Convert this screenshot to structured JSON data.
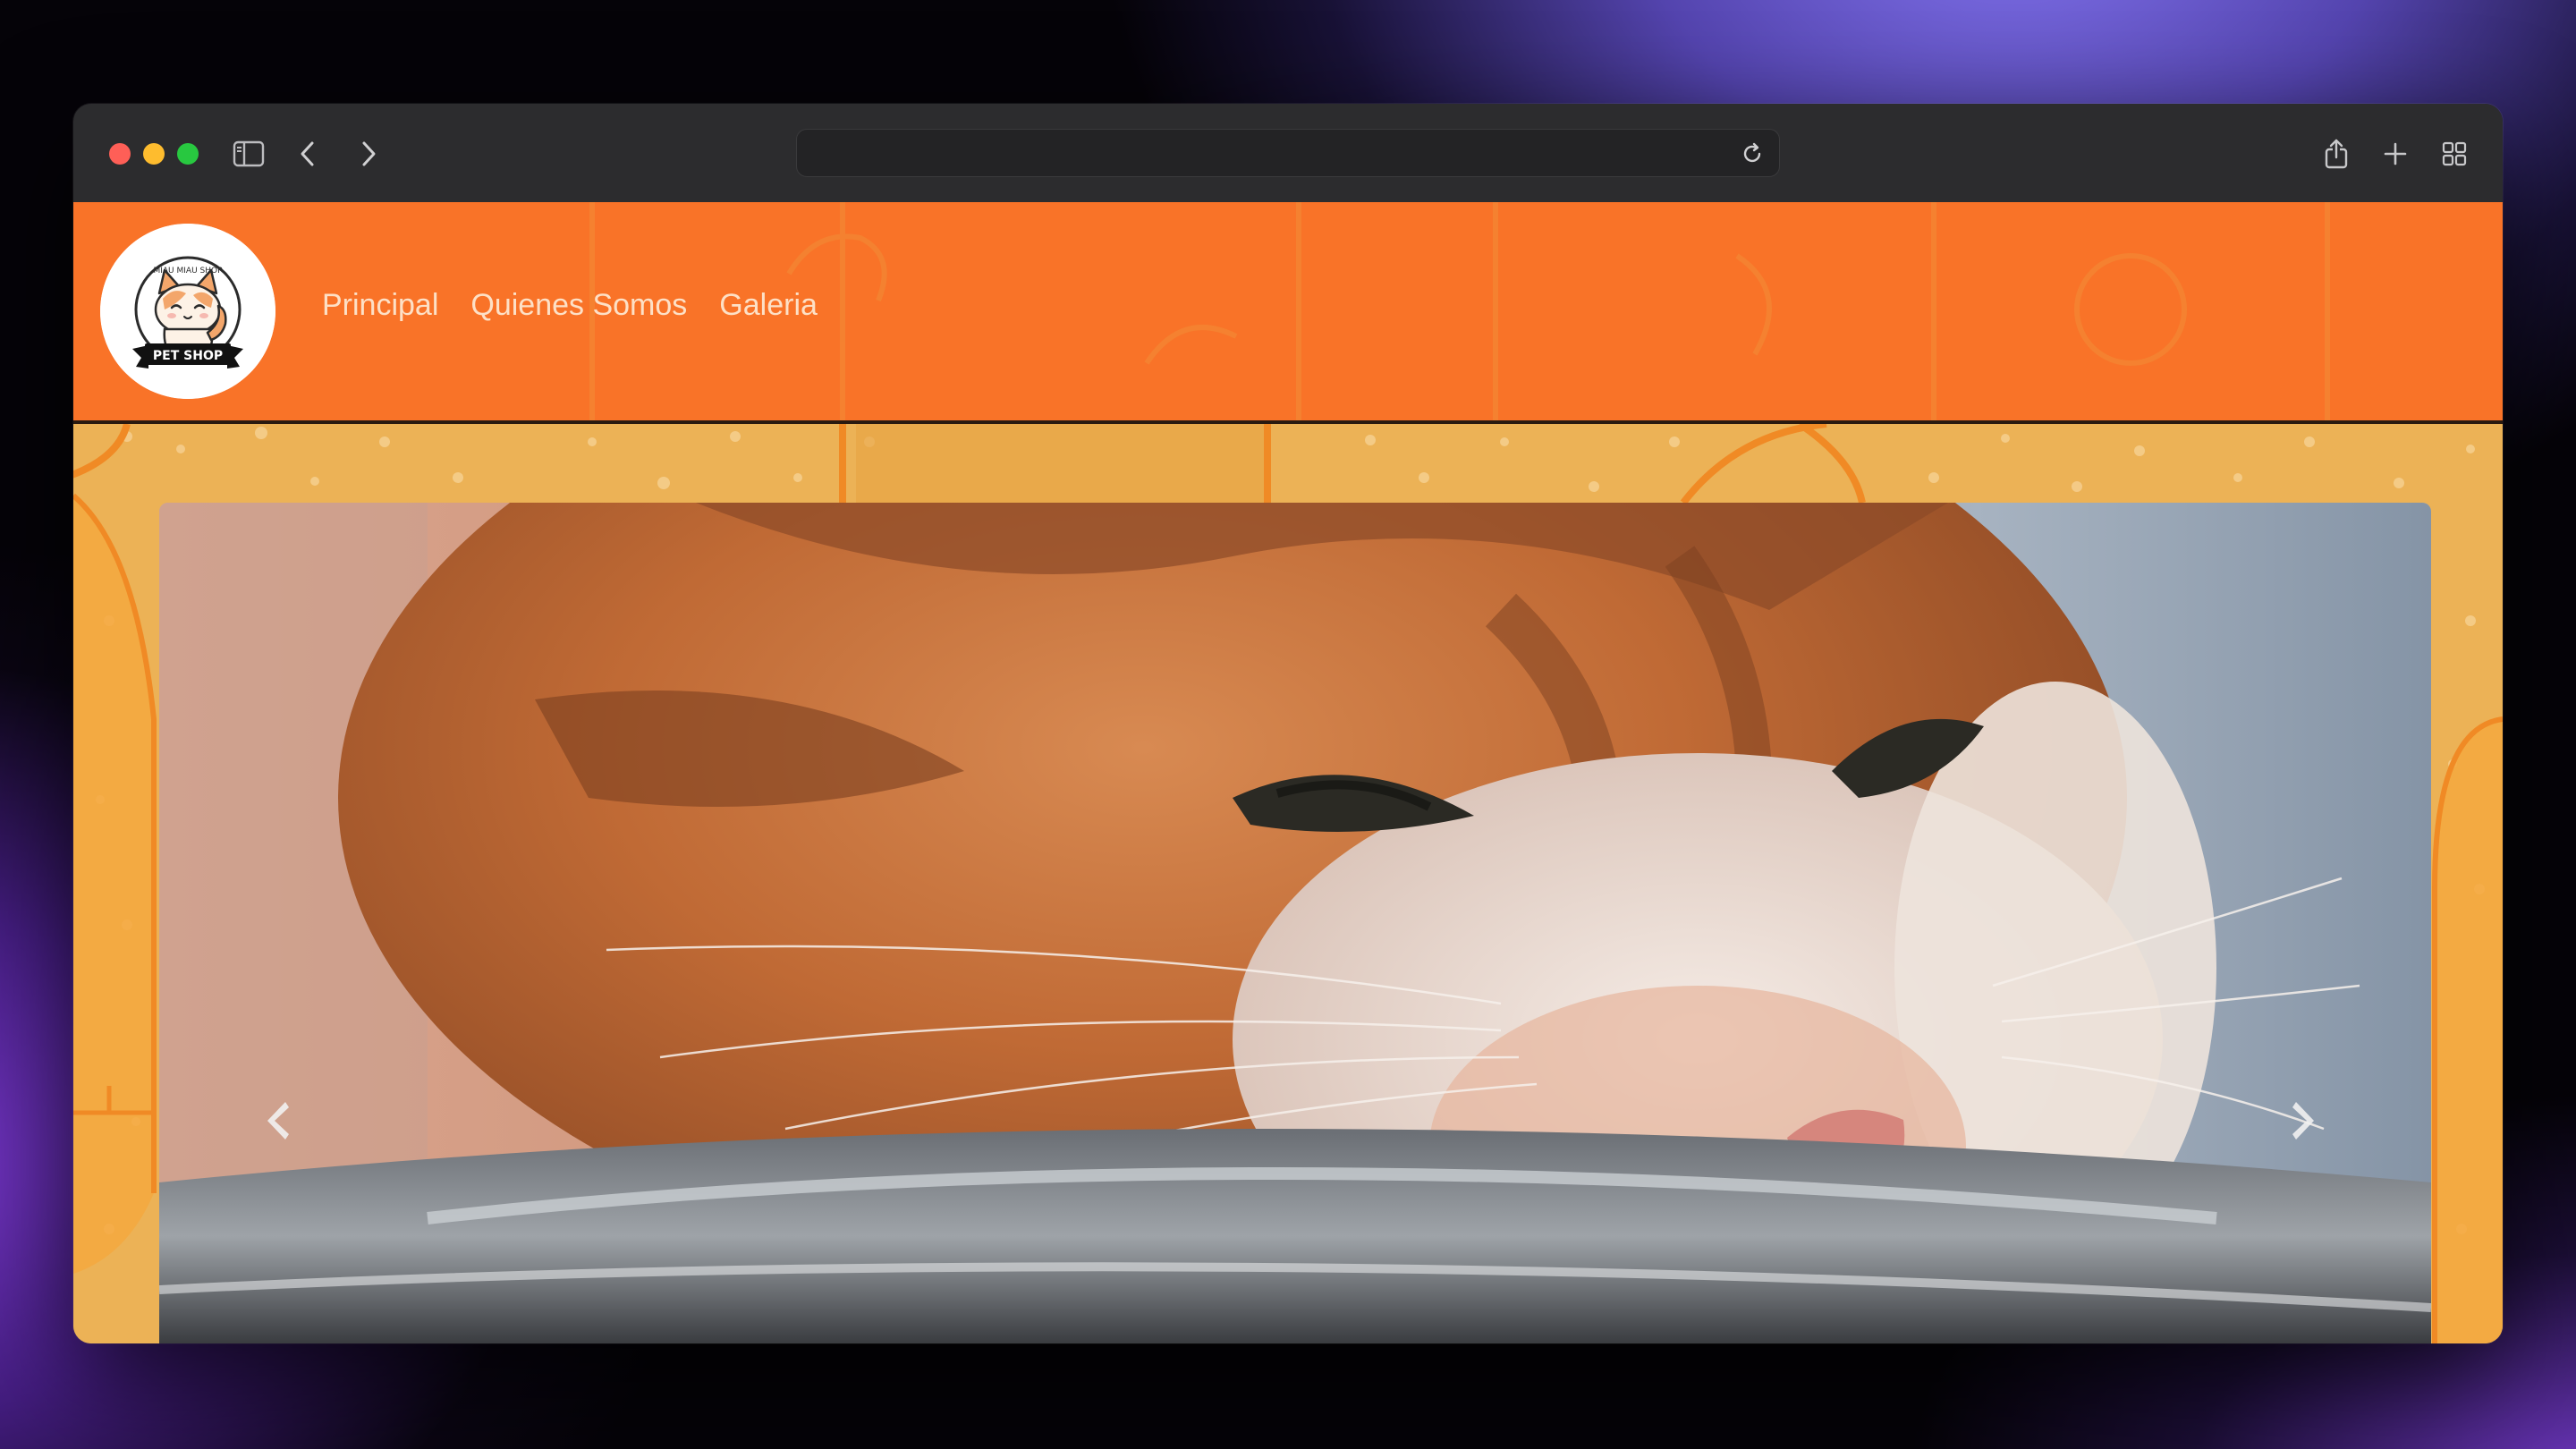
{
  "browser": {
    "address_bar_text": "",
    "icons": [
      "sidebar-icon",
      "back-icon",
      "forward-icon",
      "reload-icon",
      "share-icon",
      "new-tab-icon",
      "tab-overview-icon"
    ]
  },
  "site": {
    "logo": {
      "arc_text": "MIAU MIAU SHOP",
      "banner_text": "PET SHOP"
    },
    "nav": [
      {
        "label": "Principal"
      },
      {
        "label": "Quienes Somos"
      },
      {
        "label": "Galeria"
      }
    ],
    "colors": {
      "header": "#f97328",
      "background": "#ecb256",
      "nav_text": "#fde0c6"
    }
  },
  "carousel": {
    "image_subject": "orange-and-white kitten eating from a metal bowl",
    "controls": [
      "previous-slide-icon",
      "next-slide-icon"
    ]
  }
}
